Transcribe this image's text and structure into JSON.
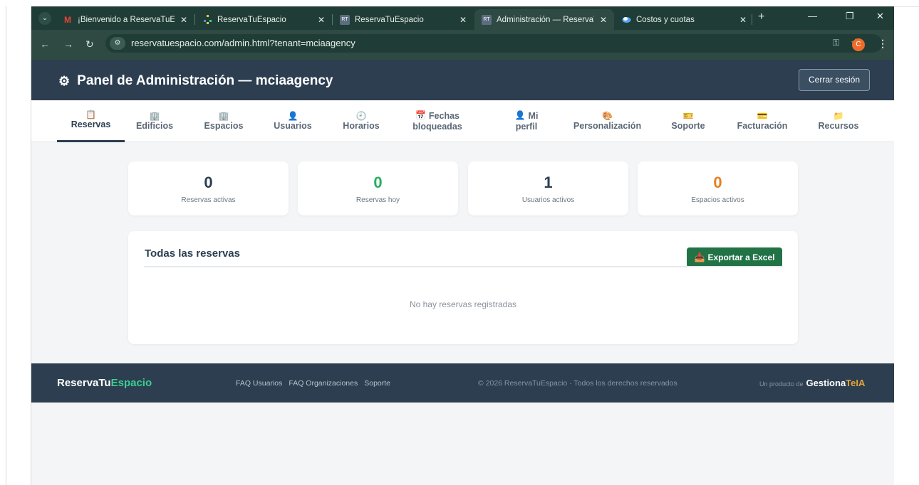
{
  "browser": {
    "tabs": [
      {
        "title": "¡Bienvenido a ReservaTuEspa",
        "favicon": "gmail-icon"
      },
      {
        "title": "ReservaTuEspacio",
        "favicon": "site-icon"
      },
      {
        "title": "ReservaTuEspacio",
        "favicon": "site-icon"
      },
      {
        "title": "Administración — ReservaTu",
        "favicon": "site-icon"
      },
      {
        "title": "Costos y cuotas",
        "favicon": "cloud-icon"
      }
    ],
    "active_tab": 3,
    "url": "reservatuespacio.com/admin.html?tenant=mciaagency",
    "profile_initial": "C"
  },
  "header": {
    "title": "Panel de Administración — mciaagency",
    "logout_label": "Cerrar sesión"
  },
  "nav": {
    "tabs": [
      {
        "icon": "📋",
        "line1": "Reservas",
        "line2": ""
      },
      {
        "icon": "🏢",
        "line1": "Edificios",
        "line2": ""
      },
      {
        "icon": "🏢",
        "line1": "Espacios",
        "line2": ""
      },
      {
        "icon": "👤",
        "line1": "Usuarios",
        "line2": ""
      },
      {
        "icon": "🕘",
        "line1": "Horarios",
        "line2": ""
      },
      {
        "icon": "📅",
        "line1": "Fechas",
        "line2": "bloqueadas"
      },
      {
        "icon": "👤",
        "line1": "Mi",
        "line2": "perfil"
      },
      {
        "icon": "🎨",
        "line1": "Personalización",
        "line2": ""
      },
      {
        "icon": "🎫",
        "line1": "Soporte",
        "line2": ""
      },
      {
        "icon": "💳",
        "line1": "Facturación",
        "line2": ""
      },
      {
        "icon": "📁",
        "line1": "Recursos",
        "line2": ""
      }
    ],
    "active": "Reservas"
  },
  "stats": [
    {
      "value": "0",
      "label": "Reservas activas",
      "color": "#2c3e50"
    },
    {
      "value": "0",
      "label": "Reservas hoy",
      "color": "#27ae60"
    },
    {
      "value": "1",
      "label": "Usuarios activos",
      "color": "#2c3e50"
    },
    {
      "value": "0",
      "label": "Espacios activos",
      "color": "#e67e22"
    }
  ],
  "reservations": {
    "title": "Todas las reservas",
    "export_label": "Exportar a Excel",
    "empty_message": "No hay reservas registradas"
  },
  "footer": {
    "brand_part1": "ReservaTu",
    "brand_part2": "Espacio",
    "links": [
      "FAQ Usuarios",
      "FAQ Organizaciones",
      "Soporte"
    ],
    "copyright": "© 2026 ReservaTuEspacio · Todos los derechos reservados",
    "credit_prefix": "Un producto de",
    "credit_brand1": "Gestiona",
    "credit_brand2": "TeIA"
  },
  "colors": {
    "primary": "#2c3e50",
    "excel_green": "#217346",
    "accent_green": "#3ccf91"
  }
}
